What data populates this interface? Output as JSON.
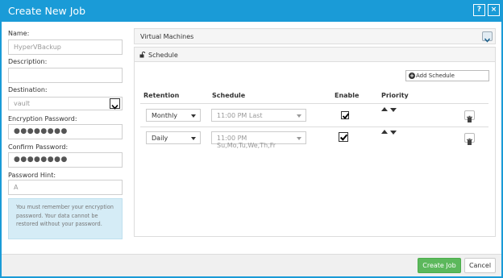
{
  "window": {
    "title": "Create New Job",
    "help_label": "?",
    "close_label": "×"
  },
  "form": {
    "name_label": "Name:",
    "name_placeholder": "HyperVBackup",
    "description_label": "Description:",
    "description_value": "",
    "destination_label": "Destination:",
    "destination_value": "vault",
    "encryption_label": "Encryption Password:",
    "encryption_value": "●●●●●●●●",
    "confirm_label": "Confirm Password:",
    "confirm_value": "●●●●●●●●",
    "hint_label": "Password Hint:",
    "hint_value": "A",
    "info_text": "You must remember your encryption password. Your data cannot be restored without your password."
  },
  "virtual_machines": {
    "label": "Virtual Machines"
  },
  "schedule": {
    "title": "Schedule",
    "add_label": "Add Schedule",
    "headers": {
      "retention": "Retention",
      "schedule": "Schedule",
      "enable": "Enable",
      "priority": "Priority"
    },
    "rows": [
      {
        "retention": "Monthly",
        "schedule": "11:00 PM Last",
        "enabled": true
      },
      {
        "retention": "Daily",
        "schedule": "11:00 PM Su,Mo,Tu,We,Th,Fr",
        "enabled": true
      }
    ]
  },
  "footer": {
    "create_label": "Create Job",
    "cancel_label": "Cancel"
  },
  "colors": {
    "accent": "#1a9bd7",
    "create": "#5cb85c",
    "info_bg": "#d5ecf6"
  }
}
